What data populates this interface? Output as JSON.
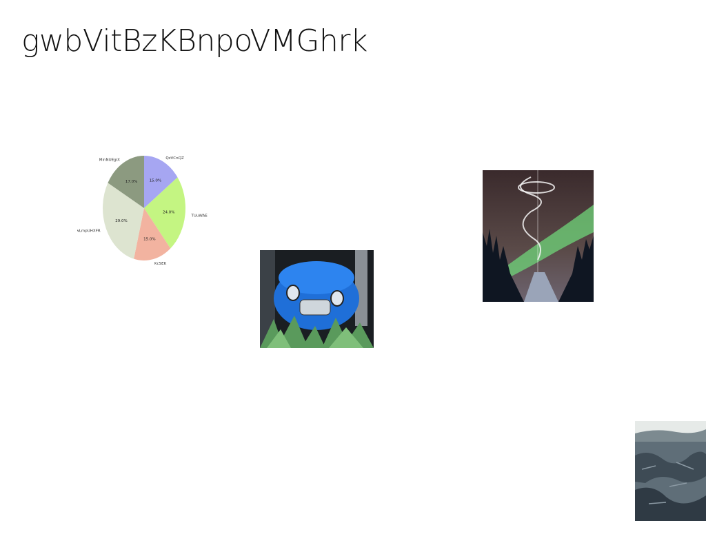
{
  "slide": {
    "title": "gwbVitBzKBnpoVMGhrk"
  },
  "chart_data": {
    "type": "pie",
    "labels": [
      "QzVCnQZ",
      "TUuWAE",
      "KcSEK",
      "wLmpUHXFR",
      "MinNUEgiX"
    ],
    "values": [
      15.0,
      24.0,
      15.0,
      29.0,
      17.0
    ],
    "value_labels": [
      "15.0%",
      "24.0%",
      "15.0%",
      "29.0%",
      "17.0%"
    ],
    "colors": [
      "#a6a6f2",
      "#c4f582",
      "#f2b3a0",
      "#dde4d0",
      "#8c9a80"
    ]
  },
  "images": {
    "car": {
      "icon": "blue-car-photo"
    },
    "aurora": {
      "icon": "aurora-road-photo"
    },
    "rocks": {
      "icon": "rocky-coast-photo"
    }
  }
}
